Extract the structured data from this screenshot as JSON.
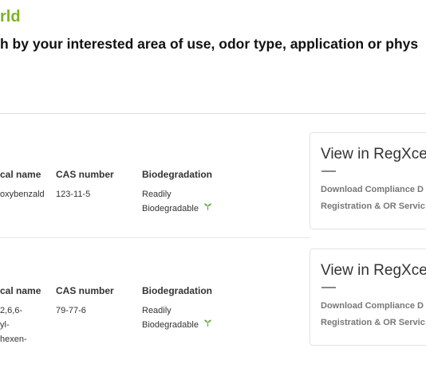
{
  "header": {
    "title": "rld",
    "search_text": "h by your interested area of use, odor type, application or phys"
  },
  "table": {
    "columns": {
      "chemical_name": "cal name",
      "cas_number": "CAS number",
      "biodegradation": "Biodegradation"
    },
    "rows": [
      {
        "chemical_name": [
          "oxybenzald"
        ],
        "cas_number": "123-11-5",
        "biodegradation": [
          "Readily",
          "Biodegradable"
        ]
      },
      {
        "chemical_name": [
          "2,6,6-",
          "yl-",
          "hexen-"
        ],
        "cas_number": "79-77-6",
        "biodegradation": [
          "Readily",
          "Biodegradable"
        ]
      }
    ]
  },
  "regx": {
    "title": "View in RegXce",
    "download_label": "Download Compliance D",
    "registration_label": "Registration & OR Servic"
  },
  "colors": {
    "accent_green": "#7ab520",
    "leaf_green": "#6aa84f"
  },
  "icons": {
    "biodegradable": "leaf-sprout-icon"
  }
}
